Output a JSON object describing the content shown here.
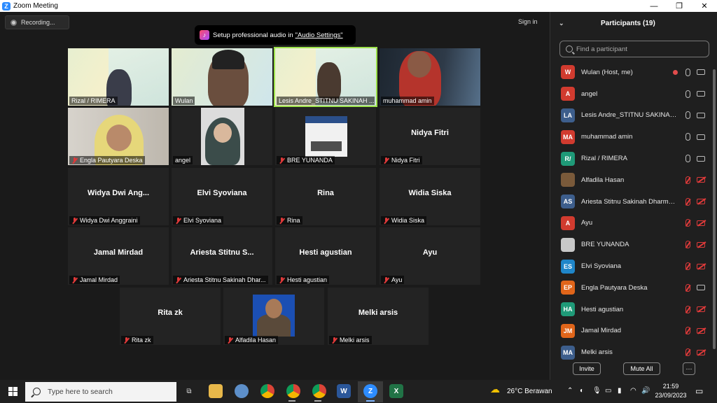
{
  "window": {
    "title": "Zoom Meeting"
  },
  "recording": {
    "label": "Recording..."
  },
  "signin": {
    "label": "Sign in"
  },
  "toast": {
    "text": "Setup professional audio in",
    "link": "\"Audio Settings\""
  },
  "tiles": [
    {
      "name": "Rizal / RIMERA",
      "video": "slide"
    },
    {
      "name": "Wulan",
      "video": "woman-headset"
    },
    {
      "name": "Lesis Andre_STITNU SAKINAH ...",
      "video": "slide-man",
      "active": true
    },
    {
      "name": "muhammad amin",
      "video": "man-red"
    },
    {
      "name": "Engla Pautyara Deska",
      "video": "hijab",
      "muted": true
    },
    {
      "name": "angel",
      "video": "girl"
    },
    {
      "name": "BRE YUNANDA",
      "video": "room",
      "muted": true
    },
    {
      "name": "Nidya Fitri",
      "big": "Nidya Fitri",
      "muted": true
    },
    {
      "name": "Widya Dwi Anggraini",
      "big": "Widya Dwi Ang...",
      "muted": true
    },
    {
      "name": "Elvi Syoviana",
      "big": "Elvi Syoviana",
      "muted": true
    },
    {
      "name": "Rina",
      "big": "Rina",
      "muted": true
    },
    {
      "name": "Widia Siska",
      "big": "Widia Siska",
      "muted": true
    },
    {
      "name": "Jamal Mirdad",
      "big": "Jamal Mirdad",
      "muted": true
    },
    {
      "name": "Ariesta Stitnu Sakinah Dhar...",
      "big": "Ariesta Stitnu S...",
      "muted": true
    },
    {
      "name": "Hesti agustian",
      "big": "Hesti agustian",
      "muted": true
    },
    {
      "name": "Ayu",
      "big": "Ayu",
      "muted": true
    },
    {
      "name": "Rita zk",
      "big": "Rita zk",
      "muted": true
    },
    {
      "name": "Alfadila Hasan",
      "video": "photo",
      "muted": true
    },
    {
      "name": "Melki arsis",
      "big": "Melki arsis",
      "muted": true
    }
  ],
  "panel": {
    "title": "Participants (19)",
    "search_placeholder": "Find a participant",
    "participants": [
      {
        "initials": "W",
        "name": "Wulan (Host, me)",
        "color": "#d13b2f",
        "mic": "on",
        "cam": "on",
        "rec": true
      },
      {
        "initials": "A",
        "name": "angel",
        "color": "#d13b2f",
        "mic": "on",
        "cam": "on"
      },
      {
        "initials": "LA",
        "name": "Lesis Andre_STITNU SAKINAH ...",
        "color": "#3d5e8c",
        "mic": "on",
        "cam": "on"
      },
      {
        "initials": "MA",
        "name": "muhammad amin",
        "color": "#d13b2f",
        "mic": "on",
        "cam": "on"
      },
      {
        "initials": "R/",
        "name": "Rizal / RIMERA",
        "color": "#1f9a78",
        "mic": "on",
        "cam": "on"
      },
      {
        "initials": "",
        "name": "Alfadila Hasan",
        "color": "#7a5a3a",
        "mic": "off",
        "cam": "off"
      },
      {
        "initials": "AS",
        "name": "Ariesta Stitnu Sakinah Dharmas...",
        "color": "#3d5e8c",
        "mic": "off",
        "cam": "off"
      },
      {
        "initials": "A",
        "name": "Ayu",
        "color": "#d13b2f",
        "mic": "off",
        "cam": "off"
      },
      {
        "initials": "",
        "name": "BRE YUNANDA",
        "color": "#c8c8c8",
        "mic": "off",
        "cam": "off"
      },
      {
        "initials": "ES",
        "name": "Elvi Syoviana",
        "color": "#1f86c9",
        "mic": "off",
        "cam": "off"
      },
      {
        "initials": "EP",
        "name": "Engla Pautyara Deska",
        "color": "#e0651a",
        "mic": "off",
        "cam": "on"
      },
      {
        "initials": "HA",
        "name": "Hesti agustian",
        "color": "#1f9a78",
        "mic": "off",
        "cam": "off"
      },
      {
        "initials": "JM",
        "name": "Jamal Mirdad",
        "color": "#e0651a",
        "mic": "off",
        "cam": "off"
      },
      {
        "initials": "MA",
        "name": "Melki arsis",
        "color": "#3d5e8c",
        "mic": "off",
        "cam": "off"
      }
    ],
    "invite_label": "Invite",
    "muteall_label": "Mute All",
    "more_label": "···"
  },
  "taskbar": {
    "search_placeholder": "Type here to search",
    "weather": "26°C  Berawan",
    "time": "21:59",
    "date": "23/09/2023"
  }
}
